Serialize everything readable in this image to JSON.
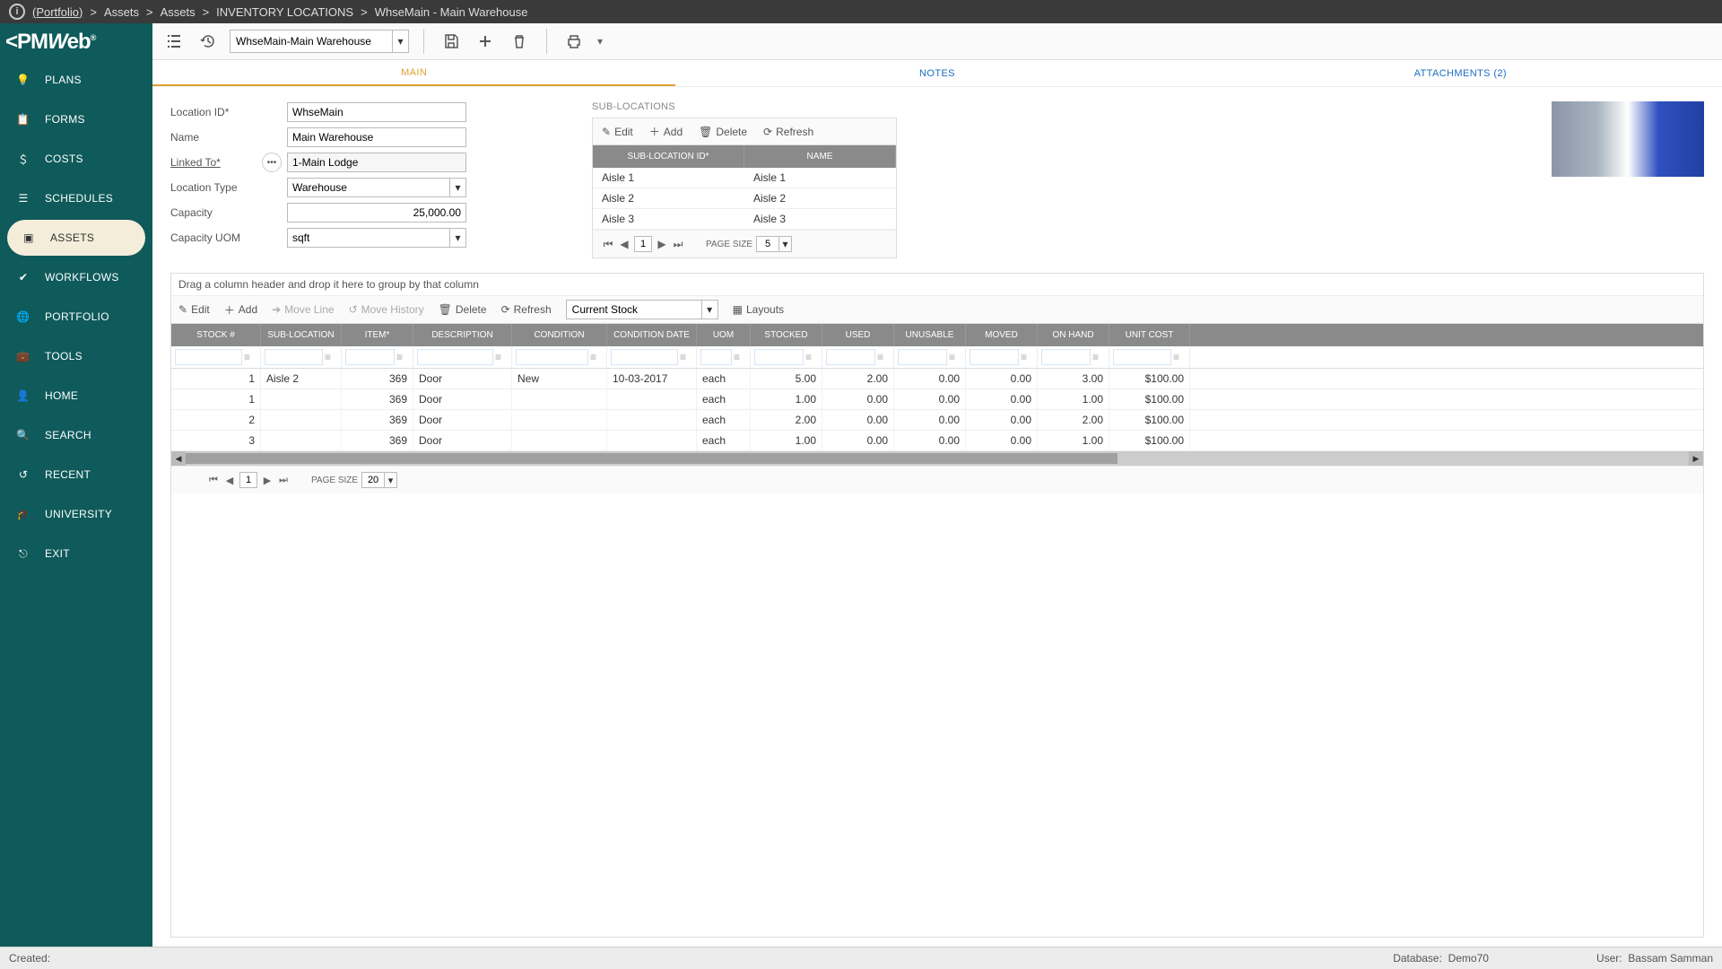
{
  "breadcrumb": {
    "portfolio": "(Portfolio)",
    "parts": [
      "Assets",
      "Assets",
      "INVENTORY LOCATIONS",
      "WhseMain - Main Warehouse"
    ]
  },
  "logo": "PMWeb",
  "sidebar": [
    {
      "label": "PLANS",
      "icon": "bulb-icon"
    },
    {
      "label": "FORMS",
      "icon": "clipboard-icon"
    },
    {
      "label": "COSTS",
      "icon": "dollar-icon"
    },
    {
      "label": "SCHEDULES",
      "icon": "bars-icon"
    },
    {
      "label": "ASSETS",
      "icon": "cube-icon",
      "active": true
    },
    {
      "label": "WORKFLOWS",
      "icon": "check-icon"
    },
    {
      "label": "PORTFOLIO",
      "icon": "globe-icon"
    },
    {
      "label": "TOOLS",
      "icon": "briefcase-icon"
    },
    {
      "label": "HOME",
      "icon": "avatar-icon"
    },
    {
      "label": "SEARCH",
      "icon": "search-icon"
    },
    {
      "label": "RECENT",
      "icon": "history-icon"
    },
    {
      "label": "UNIVERSITY",
      "icon": "grad-icon"
    },
    {
      "label": "EXIT",
      "icon": "exit-icon"
    }
  ],
  "toolbar": {
    "record_selector": "WhseMain-Main Warehouse"
  },
  "tabs": [
    {
      "label": "MAIN",
      "active": true
    },
    {
      "label": "NOTES"
    },
    {
      "label": "ATTACHMENTS (2)"
    }
  ],
  "form": {
    "location_id_label": "Location ID*",
    "location_id": "WhseMain",
    "name_label": "Name",
    "name": "Main Warehouse",
    "linked_to_label": "Linked To*",
    "linked_to": "1-Main Lodge",
    "location_type_label": "Location Type",
    "location_type": "Warehouse",
    "capacity_label": "Capacity",
    "capacity": "25,000.00",
    "capacity_uom_label": "Capacity UOM",
    "capacity_uom": "sqft"
  },
  "subloc": {
    "title": "SUB-LOCATIONS",
    "toolbar": {
      "edit": "Edit",
      "add": "Add",
      "delete": "Delete",
      "refresh": "Refresh"
    },
    "headers": {
      "id": "SUB-LOCATION ID*",
      "name": "NAME"
    },
    "rows": [
      {
        "id": "Aisle 1",
        "name": "Aisle 1"
      },
      {
        "id": "Aisle 2",
        "name": "Aisle 2"
      },
      {
        "id": "Aisle 3",
        "name": "Aisle 3"
      }
    ],
    "pager": {
      "page": "1",
      "page_size_label": "PAGE SIZE",
      "page_size": "5"
    }
  },
  "grid": {
    "group_hint": "Drag a column header and drop it here to group by that column",
    "toolbar": {
      "edit": "Edit",
      "add": "Add",
      "move_line": "Move Line",
      "move_history": "Move History",
      "delete": "Delete",
      "refresh": "Refresh",
      "filter": "Current Stock",
      "layouts": "Layouts"
    },
    "headers": [
      "STOCK #",
      "SUB-LOCATION",
      "ITEM*",
      "DESCRIPTION",
      "CONDITION",
      "CONDITION DATE",
      "UOM",
      "STOCKED",
      "USED",
      "UNUSABLE",
      "MOVED",
      "ON HAND",
      "UNIT COST"
    ],
    "rows": [
      {
        "stock": "1",
        "subloc": "Aisle 2",
        "item": "369",
        "desc": "Door",
        "cond": "New",
        "cdate": "10-03-2017",
        "uom": "each",
        "stocked": "5.00",
        "used": "2.00",
        "unusable": "0.00",
        "moved": "0.00",
        "onhand": "3.00",
        "unitcost": "$100.00"
      },
      {
        "stock": "1",
        "subloc": "",
        "item": "369",
        "desc": "Door",
        "cond": "",
        "cdate": "",
        "uom": "each",
        "stocked": "1.00",
        "used": "0.00",
        "unusable": "0.00",
        "moved": "0.00",
        "onhand": "1.00",
        "unitcost": "$100.00"
      },
      {
        "stock": "2",
        "subloc": "",
        "item": "369",
        "desc": "Door",
        "cond": "",
        "cdate": "",
        "uom": "each",
        "stocked": "2.00",
        "used": "0.00",
        "unusable": "0.00",
        "moved": "0.00",
        "onhand": "2.00",
        "unitcost": "$100.00"
      },
      {
        "stock": "3",
        "subloc": "",
        "item": "369",
        "desc": "Door",
        "cond": "",
        "cdate": "",
        "uom": "each",
        "stocked": "1.00",
        "used": "0.00",
        "unusable": "0.00",
        "moved": "0.00",
        "onhand": "1.00",
        "unitcost": "$100.00"
      }
    ],
    "pager": {
      "page": "1",
      "page_size_label": "PAGE SIZE",
      "page_size": "20"
    }
  },
  "statusbar": {
    "created": "Created:",
    "database_label": "Database:",
    "database": "Demo70",
    "user_label": "User:",
    "user": "Bassam Samman"
  }
}
